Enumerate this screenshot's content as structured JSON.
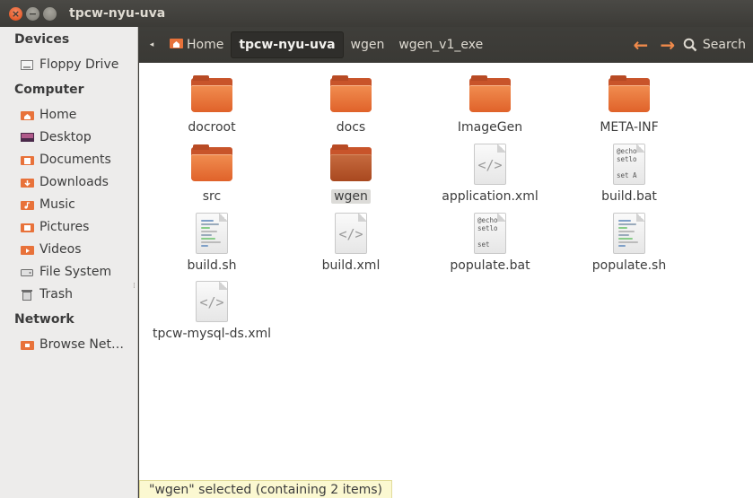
{
  "window": {
    "title": "tpcw-nyu-uva",
    "close": "×",
    "minimize": "−",
    "maximize": ""
  },
  "sidebar": {
    "sections": [
      {
        "heading": "Devices",
        "items": [
          {
            "label": "Floppy Drive",
            "icon": "floppy-icon"
          }
        ]
      },
      {
        "heading": "Computer",
        "items": [
          {
            "label": "Home",
            "icon": "home-folder-icon"
          },
          {
            "label": "Desktop",
            "icon": "desktop-icon"
          },
          {
            "label": "Documents",
            "icon": "documents-folder-icon"
          },
          {
            "label": "Downloads",
            "icon": "downloads-folder-icon"
          },
          {
            "label": "Music",
            "icon": "music-folder-icon"
          },
          {
            "label": "Pictures",
            "icon": "pictures-folder-icon"
          },
          {
            "label": "Videos",
            "icon": "videos-folder-icon"
          },
          {
            "label": "File System",
            "icon": "filesystem-icon"
          },
          {
            "label": "Trash",
            "icon": "trash-icon"
          }
        ]
      },
      {
        "heading": "Network",
        "items": [
          {
            "label": "Browse Net…",
            "icon": "network-icon"
          }
        ]
      }
    ]
  },
  "toolbar": {
    "back_glyph": "◂",
    "breadcrumbs": [
      {
        "label": "Home",
        "active": false
      },
      {
        "label": "tpcw-nyu-uva",
        "active": true
      },
      {
        "label": "wgen",
        "active": false
      },
      {
        "label": "wgen_v1_exe",
        "active": false
      }
    ],
    "prev_glyph": "←",
    "next_glyph": "→",
    "search_label": "Search"
  },
  "files": [
    {
      "name": "docroot",
      "type": "folder"
    },
    {
      "name": "docs",
      "type": "folder"
    },
    {
      "name": "ImageGen",
      "type": "folder"
    },
    {
      "name": "META-INF",
      "type": "folder"
    },
    {
      "name": "src",
      "type": "folder"
    },
    {
      "name": "wgen",
      "type": "folder",
      "selected": true
    },
    {
      "name": "application.xml",
      "type": "xml"
    },
    {
      "name": "build.bat",
      "type": "bat",
      "preview": "@echo\nsetlo\n\nset A"
    },
    {
      "name": "build.sh",
      "type": "sh"
    },
    {
      "name": "build.xml",
      "type": "xml"
    },
    {
      "name": "populate.bat",
      "type": "bat",
      "preview": "@echo\nsetlo\n\nset"
    },
    {
      "name": "populate.sh",
      "type": "sh"
    },
    {
      "name": "tpcw-mysql-ds.xml",
      "type": "xml"
    }
  ],
  "code_glyph": "</>",
  "status": "\"wgen\" selected (containing 2 items)",
  "colors": {
    "accent": "#f08a4b",
    "folder": "#e8723a",
    "titlebar": "#3c3b37",
    "sidebar": "#edeceb"
  }
}
